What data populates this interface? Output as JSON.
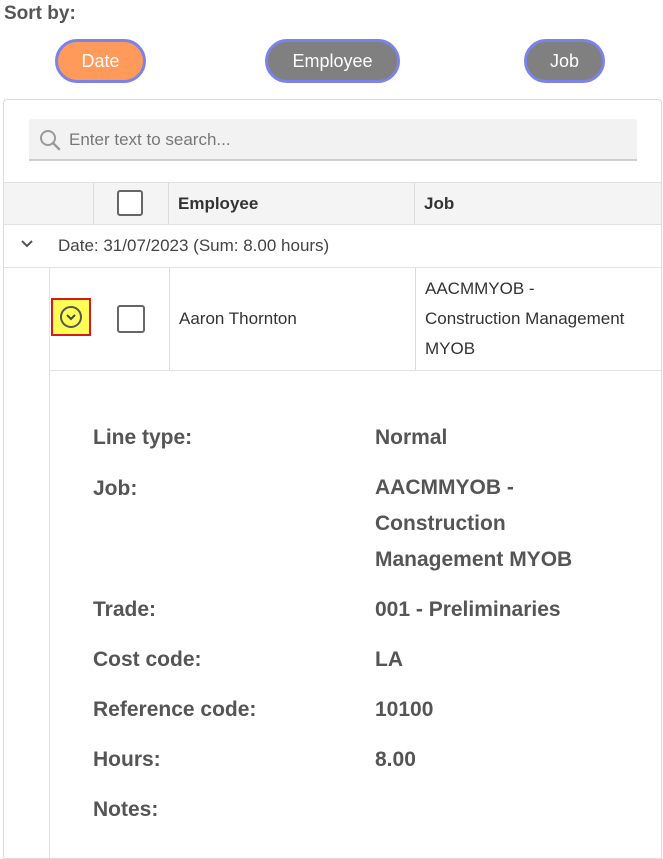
{
  "sort": {
    "label": "Sort by:",
    "buttons": [
      {
        "label": "Date",
        "active": true,
        "color": "#ff9a5a"
      },
      {
        "label": "Employee",
        "active": false,
        "color": "#808080"
      },
      {
        "label": "Job",
        "active": false,
        "color": "#808080"
      }
    ]
  },
  "search": {
    "placeholder": "Enter text to search..."
  },
  "table": {
    "columns": [
      "Employee",
      "Job"
    ],
    "group": {
      "text": "Date: 31/07/2023 (Sum: 8.00 hours)"
    },
    "rows": [
      {
        "employee": "Aaron Thornton",
        "job": "AACMMYOB - Construction Management MYOB"
      }
    ]
  },
  "detail": {
    "fields": [
      {
        "label": "Line type:",
        "value": "Normal"
      },
      {
        "label": "Job:",
        "value": "AACMMYOB - Construction Management MYOB"
      },
      {
        "label": "Trade:",
        "value": "001 - Preliminaries"
      },
      {
        "label": "Cost code:",
        "value": "LA"
      },
      {
        "label": "Reference code:",
        "value": "10100"
      },
      {
        "label": "Hours:",
        "value": "8.00"
      },
      {
        "label": "Notes:",
        "value": ""
      }
    ]
  },
  "colors": {
    "accent": "#ff9a5a",
    "button_border": "#7b82e8",
    "highlight": "#ffff55",
    "highlight_border": "#d81a1a"
  },
  "icons": [
    "search-icon",
    "chevron-down-icon",
    "circle-chevron-down-icon"
  ]
}
